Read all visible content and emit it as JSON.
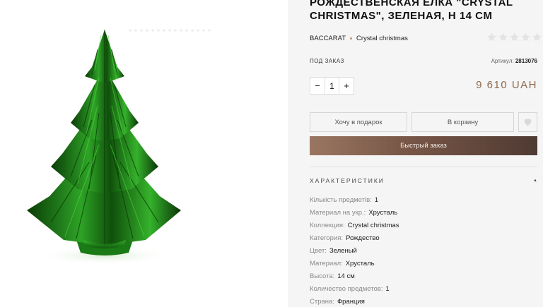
{
  "product": {
    "title": "РОЖДЕСТВЕНСКАЯ ЁЛКА \"CRYSTAL CHRISTMAS\", ЗЕЛЕНАЯ, H 14 CM",
    "brand": "BACCARAT",
    "collection": "Crystal christmas",
    "rating": 0,
    "rating_max": 5,
    "availability": "ПОД ЗАКАЗ",
    "sku_label": "Артикул:",
    "sku_value": "2813076",
    "quantity": "1",
    "price": "9 610 UAH"
  },
  "actions": {
    "minus": "−",
    "plus": "+",
    "gift_label": "Хочу в подарок",
    "cart_label": "В корзину",
    "quick_order_label": "Быстрый заказ"
  },
  "specs": {
    "title": "ХАРАКТЕРИСТИКИ",
    "toggle_symbol": "▲",
    "rows": [
      {
        "label": "Кількість предметів:",
        "value": "1"
      },
      {
        "label": "Материал на укр.:",
        "value": "Хрусталь"
      },
      {
        "label": "Коллекция:",
        "value": "Crystal christmas"
      },
      {
        "label": "Категория:",
        "value": "Рождество"
      },
      {
        "label": "Цвет:",
        "value": "Зеленый"
      },
      {
        "label": "Материал:",
        "value": "Хрусталь"
      },
      {
        "label": "Высота:",
        "value": "14 см"
      },
      {
        "label": "Количество предметов:",
        "value": "1"
      },
      {
        "label": "Страна:",
        "value": "Франция"
      }
    ]
  },
  "colors": {
    "accent": "#8c6a4f",
    "tree_green": "#1f8a1b",
    "star_empty": "#e3e3e3"
  },
  "icons": {
    "wishlist": "heart-icon",
    "rating": "star-icon"
  }
}
